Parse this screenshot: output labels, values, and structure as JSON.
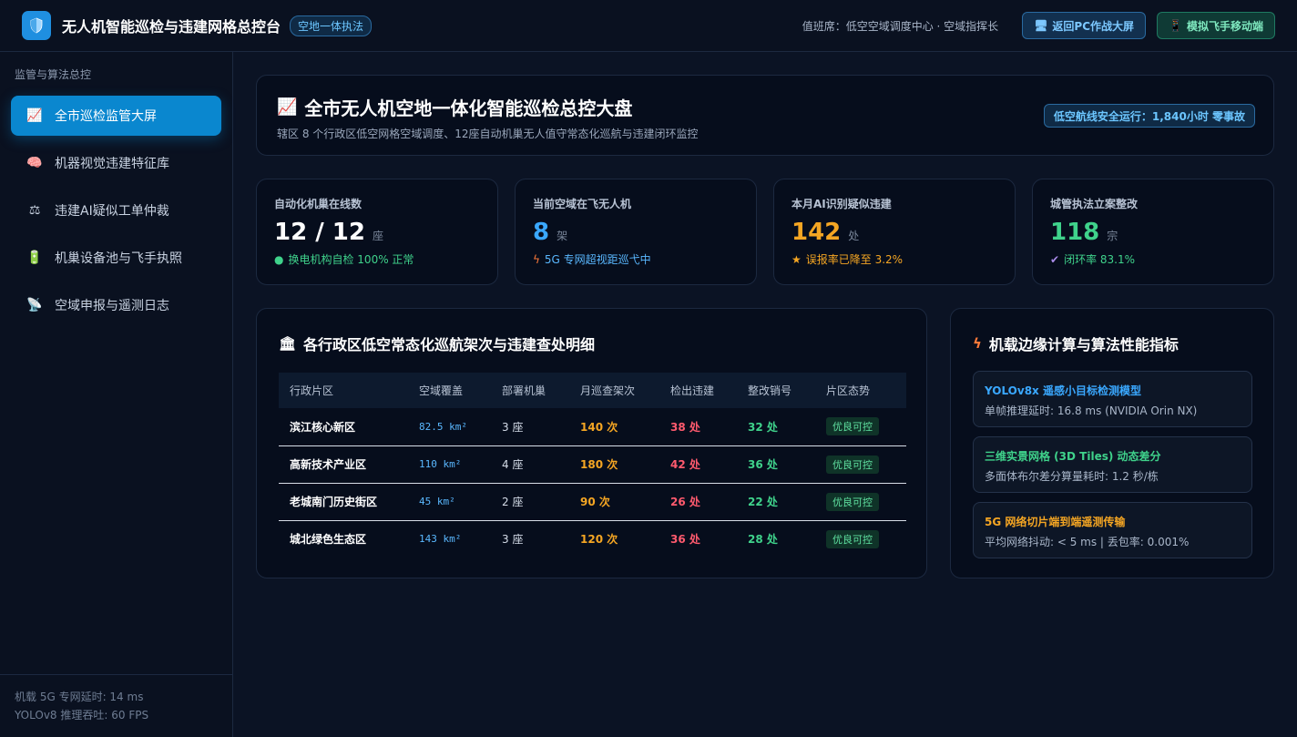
{
  "header": {
    "title": "无人机智能巡检与违建网格总控台",
    "badge": "空地一体执法",
    "duty": "值班席：低空空域调度中心 · 空域指挥长",
    "btn_pc": "返回PC作战大屏",
    "btn_mobile": "模拟飞手移动端",
    "icons": [
      "shield-icon",
      "monitor-icon",
      "phone-icon"
    ]
  },
  "sidebar": {
    "section_title": "监管与算法总控",
    "items": [
      {
        "label": "全市巡检监管大屏",
        "icon": "chart-icon",
        "active": true
      },
      {
        "label": "机器视觉违建特征库",
        "icon": "brain-icon",
        "active": false
      },
      {
        "label": "违建AI疑似工单仲裁",
        "icon": "scale-icon",
        "active": false
      },
      {
        "label": "机巢设备池与飞手执照",
        "icon": "battery-icon",
        "active": false
      },
      {
        "label": "空域申报与遥测日志",
        "icon": "satellite-icon",
        "active": false
      }
    ],
    "footer_latency": "机载 5G 专网延时: 14 ms",
    "footer_fps": "YOLOv8 推理吞吐: 60 FPS"
  },
  "hero": {
    "title": "全市无人机空地一体化智能巡检总控大盘",
    "subtitle": "辖区 8 个行政区低空网格空域调度、12座自动机巢无人值守常态化巡航与违建闭环监控",
    "pill": "低空航线安全运行：1,840小时 零事故"
  },
  "kpis": [
    {
      "label": "自动化机巢在线数",
      "value": "12 / 12",
      "unit": "座",
      "foot": "换电机构自检 100% 正常",
      "foot_icon": "dot-icon",
      "color": "#ffffff",
      "foot_color": "#3fd28b"
    },
    {
      "label": "当前空域在飞无人机",
      "value": "8",
      "unit": "架",
      "foot": "5G 专网超视距巡弋中",
      "foot_icon": "bolt-icon",
      "color": "#3aa8ff",
      "foot_color": "#5ab8ff"
    },
    {
      "label": "本月AI识别疑似违建",
      "value": "142",
      "unit": "处",
      "foot": "误报率已降至 3.2%",
      "foot_icon": "star-icon",
      "color": "#f5a623",
      "foot_color": "#f5a623"
    },
    {
      "label": "城管执法立案整改",
      "value": "118",
      "unit": "宗",
      "foot": "闭环率 83.1%",
      "foot_icon": "check-icon",
      "color": "#3fd28b",
      "foot_color": "#3fd28b"
    }
  ],
  "district_table": {
    "title": "各行政区低空常态化巡航架次与违建查处明细",
    "columns": [
      "行政片区",
      "空域覆盖",
      "部署机巢",
      "月巡查架次",
      "检出违建",
      "整改销号",
      "片区态势"
    ],
    "rows": [
      {
        "name": "滨江核心新区",
        "area": "82.5 km²",
        "nests": "3 座",
        "month": "140 次",
        "found": "38 处",
        "fixed": "32 处",
        "status": "优良可控"
      },
      {
        "name": "高新技术产业区",
        "area": "110 km²",
        "nests": "4 座",
        "month": "180 次",
        "found": "42 处",
        "fixed": "36 处",
        "status": "优良可控"
      },
      {
        "name": "老城南门历史街区",
        "area": "45 km²",
        "nests": "2 座",
        "month": "90 次",
        "found": "26 处",
        "fixed": "22 处",
        "status": "优良可控"
      },
      {
        "name": "城北绿色生态区",
        "area": "143 km²",
        "nests": "3 座",
        "month": "120 次",
        "found": "36 处",
        "fixed": "28 处",
        "status": "优良可控"
      }
    ]
  },
  "perf": {
    "title": "机载边缘计算与算法性能指标",
    "items": [
      {
        "name": "YOLOv8x 遥感小目标检测模型",
        "desc": "单帧推理延时: 16.8 ms (NVIDIA Orin NX)",
        "color": "#3aa8ff"
      },
      {
        "name": "三维实景网格 (3D Tiles) 动态差分",
        "desc": "多面体布尔差分算量耗时: 1.2 秒/栋",
        "color": "#3fd28b"
      },
      {
        "name": "5G 网络切片端到端遥测传输",
        "desc": "平均网络抖动: < 5 ms | 丢包率: 0.001%",
        "color": "#f5a623"
      }
    ]
  }
}
